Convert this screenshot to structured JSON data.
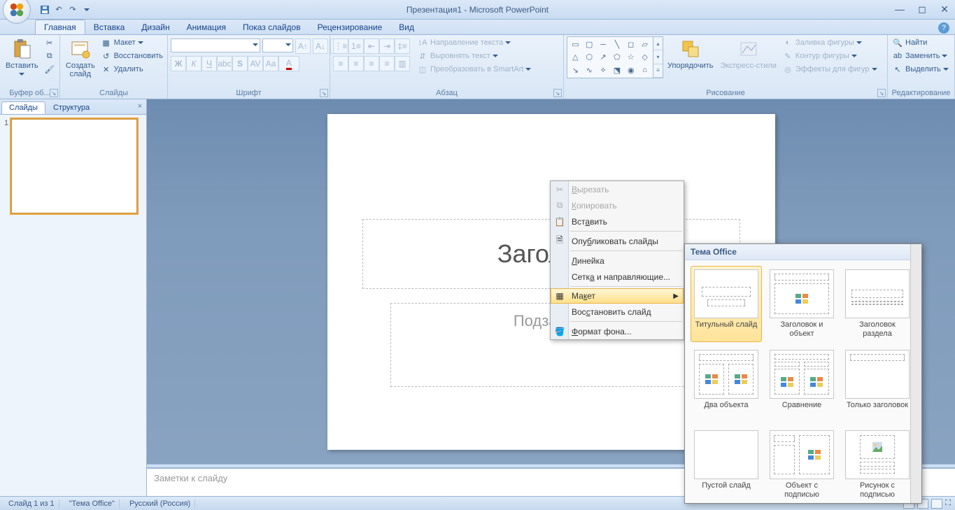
{
  "title": "Презентация1 - Microsoft PowerPoint",
  "tabs": {
    "home": "Главная",
    "insert": "Вставка",
    "design": "Дизайн",
    "anim": "Анимация",
    "show": "Показ слайдов",
    "review": "Рецензирование",
    "view": "Вид"
  },
  "ribbon": {
    "clipboard": {
      "label": "Буфер об...",
      "paste": "Вставить"
    },
    "slides": {
      "label": "Слайды",
      "new": "Создать\nслайд",
      "layout": "Макет",
      "reset": "Восстановить",
      "delete": "Удалить"
    },
    "font": {
      "label": "Шрифт"
    },
    "para": {
      "label": "Абзац",
      "dir": "Направление текста",
      "align": "Выровнять текст",
      "smart": "Преобразовать в SmartArt"
    },
    "draw": {
      "label": "Рисование",
      "arrange": "Упорядочить",
      "styles": "Экспресс-стили",
      "fill": "Заливка фигуры",
      "outline": "Контур фигуры",
      "effects": "Эффекты для фигур"
    },
    "edit": {
      "label": "Редактирование",
      "find": "Найти",
      "replace": "Заменить",
      "select": "Выделить"
    }
  },
  "left": {
    "slides": "Слайды",
    "outline": "Структура",
    "num": "1"
  },
  "slide": {
    "title": "Заголово",
    "sub": "Подзаголо"
  },
  "notes": "Заметки к слайду",
  "status": {
    "pos": "Слайд 1 из 1",
    "theme": "\"Тема Office\"",
    "lang": "Русский (Россия)"
  },
  "ctx": {
    "cut": "Вырезать",
    "copy": "Копировать",
    "paste": "Вставить",
    "publish": "Опубликовать слайды",
    "ruler": "Линейка",
    "grid": "Сетка и направляющие...",
    "layout": "Макет",
    "reset": "Восстановить слайд",
    "format": "Формат фона..."
  },
  "gallery": {
    "header": "Тема Office",
    "items": [
      "Титульный слайд",
      "Заголовок и объект",
      "Заголовок раздела",
      "Два объекта",
      "Сравнение",
      "Только заголовок",
      "Пустой слайд",
      "Объект с подписью",
      "Рисунок с подписью"
    ]
  }
}
